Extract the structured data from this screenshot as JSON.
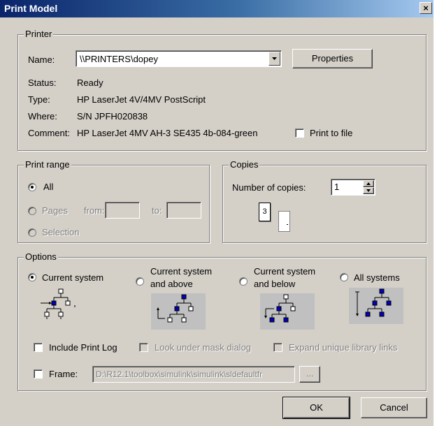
{
  "window": {
    "title": "Print Model",
    "close_symbol": "×"
  },
  "printer": {
    "group_label": "Printer",
    "name_label": "Name:",
    "name_value": "\\\\PRINTERS\\dopey",
    "properties_label": "Properties",
    "status_label": "Status:",
    "status_value": "Ready",
    "type_label": "Type:",
    "type_value": "HP LaserJet 4V/4MV PostScript",
    "where_label": "Where:",
    "where_value": "S/N JPFH020838",
    "comment_label": "Comment:",
    "comment_value": "HP LaserJet 4MV AH-3 SE435 4b-084-green",
    "print_to_file_label": "Print to file",
    "print_to_file_checked": false
  },
  "print_range": {
    "group_label": "Print range",
    "all_label": "All",
    "pages_label": "Pages",
    "from_label": "from:",
    "to_label": "to:",
    "selection_label": "Selection",
    "selected": "All"
  },
  "copies": {
    "group_label": "Copies",
    "number_label": "Number of copies:",
    "number_value": "1",
    "collate_page_label": "3"
  },
  "options": {
    "group_label": "Options",
    "current_system_label": "Current system",
    "current_and_above_label_1": "Current system",
    "current_and_above_label_2": "and above",
    "current_and_below_label_1": "Current system",
    "current_and_below_label_2": "and below",
    "all_systems_label": "All systems",
    "selected": "Current system",
    "include_print_log_label": "Include Print Log",
    "look_under_mask_label": "Look under mask dialog",
    "expand_library_links_label": "Expand unique library links",
    "frame_label": "Frame:",
    "frame_value": "D:\\R12.1\\toolbox\\simulink\\simulink\\sldefaultfr",
    "browse_label": "..."
  },
  "buttons": {
    "ok_label": "OK",
    "cancel_label": "Cancel"
  },
  "colors": {
    "dialog_face": "#d4d0c8",
    "title_bar_start": "#0a246a",
    "title_bar_end": "#a6caf0",
    "highlight_block": "#0000c0"
  }
}
